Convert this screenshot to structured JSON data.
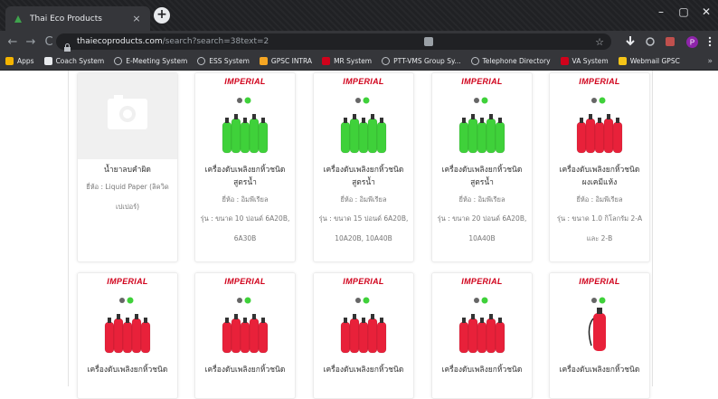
{
  "browser": {
    "tab_title": "Thai Eco Products",
    "tab_close": "×",
    "new_tab": "+",
    "window_controls": {
      "minimize": "–",
      "maximize": "▢",
      "close": "✕"
    },
    "nav": {
      "back": "←",
      "forward": "→",
      "reload": "C"
    },
    "url_domain": "thaiecoproducts.com",
    "url_path": "/search?search=38text=2",
    "star": "☆"
  },
  "bookmarks": [
    {
      "label": "Apps",
      "icon": "apps-grid-icon",
      "color": "#f4b400"
    },
    {
      "label": "Coach System",
      "icon": "folder-icon",
      "color": "#e8eaed"
    },
    {
      "label": "E-Meeting System",
      "icon": "globe-icon",
      "color": ""
    },
    {
      "label": "ESS System",
      "icon": "globe-icon",
      "color": ""
    },
    {
      "label": "GPSC INTRA",
      "icon": "site-icon",
      "color": "#f6a623"
    },
    {
      "label": "MR System",
      "icon": "site-icon",
      "color": "#d0021b"
    },
    {
      "label": "PTT-VMS Group Sy...",
      "icon": "globe-icon",
      "color": ""
    },
    {
      "label": "Telephone Directory",
      "icon": "globe-icon",
      "color": ""
    },
    {
      "label": "VA System",
      "icon": "site-icon",
      "color": "#d0021b"
    },
    {
      "label": "Webmail GPSC",
      "icon": "site-icon",
      "color": "#f5c518"
    }
  ],
  "bookmarks_more": "»",
  "products_row1": [
    {
      "name": "น้ำยาลบคำผิด",
      "brand": "ยี่ห้อ : Liquid Paper (ลิควิด",
      "brand2": "เปเปอร์)",
      "model": "",
      "model2": "",
      "image": "placeholder"
    },
    {
      "name": "เครื่องดับเพลิงยกหิ้วชนิด",
      "name2": "สูตรน้ำ",
      "brand": "ยี่ห้อ : อิมพีเรียล",
      "model": "รุ่น : ขนาด 10 ปอนด์ 6A20B,",
      "model2": "6A30B",
      "image": "green"
    },
    {
      "name": "เครื่องดับเพลิงยกหิ้วชนิด",
      "name2": "สูตรน้ำ",
      "brand": "ยี่ห้อ : อิมพีเรียล",
      "model": "รุ่น : ขนาด 15 ปอนด์ 6A20B,",
      "model2": "10A20B, 10A40B",
      "image": "green"
    },
    {
      "name": "เครื่องดับเพลิงยกหิ้วชนิด",
      "name2": "สูตรน้ำ",
      "brand": "ยี่ห้อ : อิมพีเรียล",
      "model": "รุ่น : ขนาด 20 ปอนด์ 6A20B,",
      "model2": "10A40B",
      "image": "green"
    },
    {
      "name": "เครื่องดับเพลิงยกหิ้วชนิด",
      "name2": "ผงเคมีแห้ง",
      "brand": "ยี่ห้อ : อิมพีเรียล",
      "model": "รุ่น : ขนาด 1.0 กิโลกรัม 2-A",
      "model2": "และ 2-B",
      "image": "red"
    }
  ],
  "products_row2": [
    {
      "name": "เครื่องดับเพลิงยกหิ้วชนิด",
      "image": "red"
    },
    {
      "name": "เครื่องดับเพลิงยกหิ้วชนิด",
      "image": "red"
    },
    {
      "name": "เครื่องดับเพลิงยกหิ้วชนิด",
      "image": "red"
    },
    {
      "name": "เครื่องดับเพลิงยกหิ้วชนิด",
      "image": "red"
    },
    {
      "name": "เครื่องดับเพลิงยกหิ้วชนิด",
      "image": "single-red"
    }
  ],
  "image_brand": "IMPERIAL",
  "colors": {
    "green_tank": "#3fd13a",
    "red_tank": "#e8213a",
    "brand_red": "#d0021b"
  }
}
